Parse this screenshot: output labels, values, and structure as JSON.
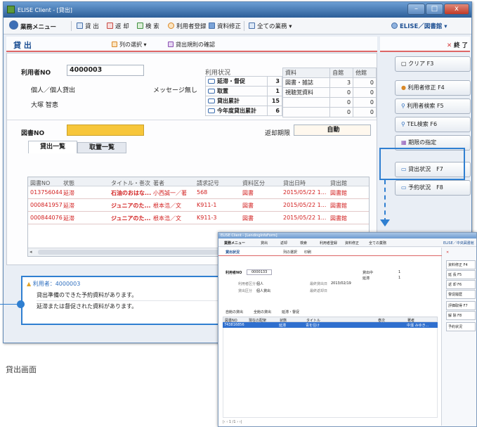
{
  "window": {
    "title": "ELISE Client - [貸出]",
    "min": "–",
    "max": "□",
    "close": "x"
  },
  "menu": {
    "main": "業務メニュー",
    "lend": "貸 出",
    "return": "返 却",
    "search": "検 索",
    "user_reg": "利用者登録",
    "item_edit": "資料修正",
    "all_tasks": "全ての業務",
    "library": "ELISE／図書館"
  },
  "screen": {
    "title": "貸 出",
    "col_select": "列の選択",
    "rule_check": "貸出規則の確認",
    "end": "終 了"
  },
  "user": {
    "no_label": "利用者NO",
    "no_value": "4000003",
    "type": "個人／個人貸出",
    "message": "メッセージ無し",
    "name": "大塚 智恵"
  },
  "status": {
    "label": "利用状況",
    "rows": [
      {
        "label": "延滞・督促",
        "value": "3"
      },
      {
        "label": "取置",
        "value": "1"
      },
      {
        "label": "貸出累計",
        "value": "15"
      },
      {
        "label": "今年度貸出累計",
        "value": "6"
      }
    ]
  },
  "item_stats": {
    "headers": [
      "資料",
      "自館",
      "他館"
    ],
    "rows": [
      [
        "図書・雑誌",
        "3",
        "0"
      ],
      [
        "視聴覚資料",
        "0",
        "0"
      ],
      [
        "",
        "0",
        "0"
      ],
      [
        "",
        "0",
        "0"
      ]
    ]
  },
  "book": {
    "no_label": "図書NO",
    "due_label": "返却期限",
    "due_value": "自動"
  },
  "tabs": {
    "lending": "貸出一覧",
    "reserve": "取置一覧"
  },
  "grid": {
    "headers": [
      "図書NO",
      "状態",
      "タイトル・巻次",
      "著者",
      "請求記号",
      "資料区分",
      "貸出日時",
      "貸出館"
    ],
    "rows": [
      [
        "013756044",
        "延滞",
        "石油のおはな...",
        "小西誠一／著",
        "568",
        "図書",
        "2015/05/22 1...",
        "図書館"
      ],
      [
        "000841957",
        "延滞",
        "ジュニアのた...",
        "根本浩／文",
        "K911-1",
        "図書",
        "2015/05/22 1...",
        "図書館"
      ],
      [
        "000844076",
        "延滞",
        "ジュニアのた...",
        "根本浩／文",
        "K911-3",
        "図書",
        "2015/05/22 1...",
        "図書館"
      ]
    ]
  },
  "buttons": {
    "clear": "クリア F3",
    "user_edit": "利用者修正 F4",
    "user_search": "利用者検索 F5",
    "tel_search": "TEL検索 F6",
    "due_spec": "期限の指定",
    "lend_status": "貸出状況　F7",
    "reserve_status": "予約状況　F8"
  },
  "messages": {
    "user": "利用者：4000003",
    "lines": [
      "貸出準備のできた予約資料があります。",
      "延滞または督促された資料があります。"
    ]
  },
  "caption": "貸出画面",
  "sub": {
    "title": "ELISE Client - [LendingInfoForm]",
    "menu": [
      "業務メニュー",
      "貸出",
      "返却",
      "検索",
      "利用者登録",
      "資料修正",
      "全ての業務"
    ],
    "library": "ELISE／中央図書館",
    "screen_title": "貸出状況",
    "col_select": "列の選択",
    "print": "印刷",
    "user_no_label": "利用者NO",
    "user_no": "0000133",
    "user_type_label": "利用者区分",
    "user_type": "個人",
    "reg_date_label": "最終貸出日",
    "reg_date": "2013/02/19",
    "lend_type_label": "貸出区分",
    "lend_type": "個人貸出",
    "upd_date_label": "最終返却日",
    "stat1": "貸出中",
    "stat1v": "1",
    "stat2": "延滞",
    "stat2v": "1",
    "radios": [
      "自館の貸出",
      "全館の貸出",
      "延滞・督促"
    ],
    "grid_headers": [
      "図書NO",
      "現在の配架",
      "状態",
      "タイトル",
      "巻次",
      "著者"
    ],
    "grid_row": [
      "743816856",
      "",
      "延滞",
      "青を往け",
      "",
      "中濱 みゆき..."
    ],
    "side": [
      "資料修正 F4",
      "延 長 F5",
      "返 却 F6",
      "督促履歴",
      "評価取得 F7",
      "解 除 F8",
      "予約状況"
    ],
    "pager": "|‹ ‹ 1 /1 › ›|"
  }
}
